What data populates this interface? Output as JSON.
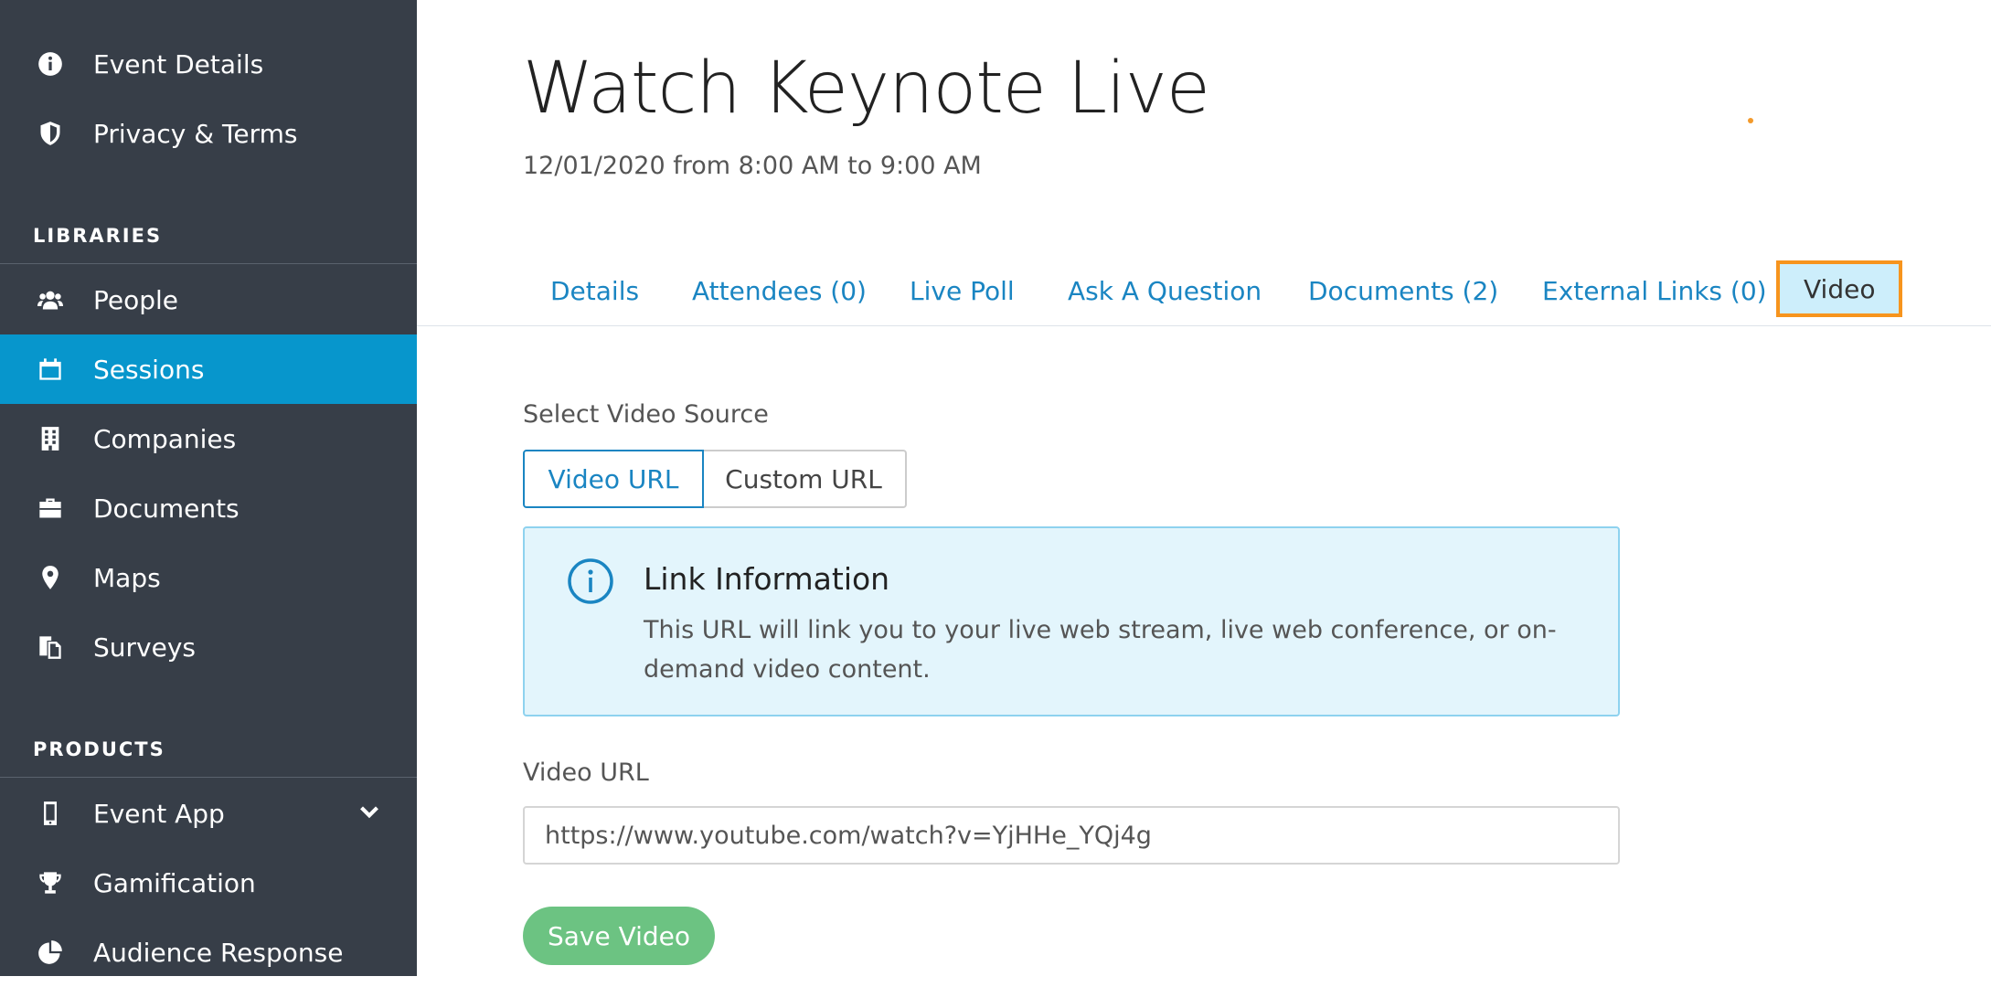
{
  "sidebar": {
    "top_items": [
      {
        "label": "Event Details",
        "icon": "info-circle-icon"
      },
      {
        "label": "Privacy & Terms",
        "icon": "shield-icon"
      }
    ],
    "libraries_title": "LIBRARIES",
    "libraries": [
      {
        "label": "People",
        "icon": "users-icon"
      },
      {
        "label": "Sessions",
        "icon": "calendar-icon",
        "active": true
      },
      {
        "label": "Companies",
        "icon": "building-icon"
      },
      {
        "label": "Documents",
        "icon": "briefcase-icon"
      },
      {
        "label": "Maps",
        "icon": "map-pin-icon"
      },
      {
        "label": "Surveys",
        "icon": "copy-icon"
      }
    ],
    "products_title": "PRODUCTS",
    "products": [
      {
        "label": "Event App",
        "icon": "mobile-icon",
        "expandable": true
      },
      {
        "label": "Gamification",
        "icon": "trophy-icon"
      },
      {
        "label": "Audience Response",
        "icon": "pie-chart-icon"
      }
    ]
  },
  "header": {
    "title": "Watch Keynote Live",
    "subtitle": "12/01/2020 from 8:00 AM to 9:00 AM"
  },
  "tabs": [
    {
      "label": "Details"
    },
    {
      "label": "Attendees (0)"
    },
    {
      "label": "Live Poll"
    },
    {
      "label": "Ask A Question"
    },
    {
      "label": "Documents (2)"
    },
    {
      "label": "External Links (0)"
    },
    {
      "label": "Video",
      "active": true
    }
  ],
  "video_source": {
    "label": "Select Video Source",
    "options": [
      "Video URL",
      "Custom URL"
    ],
    "selected": "Video URL"
  },
  "info_box": {
    "icon": "info-circle-icon",
    "title": "Link Information",
    "text": "This URL will link you to your live web stream, live web conference, or on-demand video content."
  },
  "video_url": {
    "label": "Video URL",
    "value": "https://www.youtube.com/watch?v=YjHHe_YQj4g"
  },
  "save_button": "Save Video",
  "colors": {
    "sidebar_bg": "#373e48",
    "active_nav": "#0796cc",
    "link": "#1a85c2",
    "active_tab_bg": "#cdeefb",
    "active_tab_border": "#f7941d",
    "info_bg": "#e3f5fc",
    "info_border": "#8ed2ef",
    "save_button": "#6cc382"
  }
}
